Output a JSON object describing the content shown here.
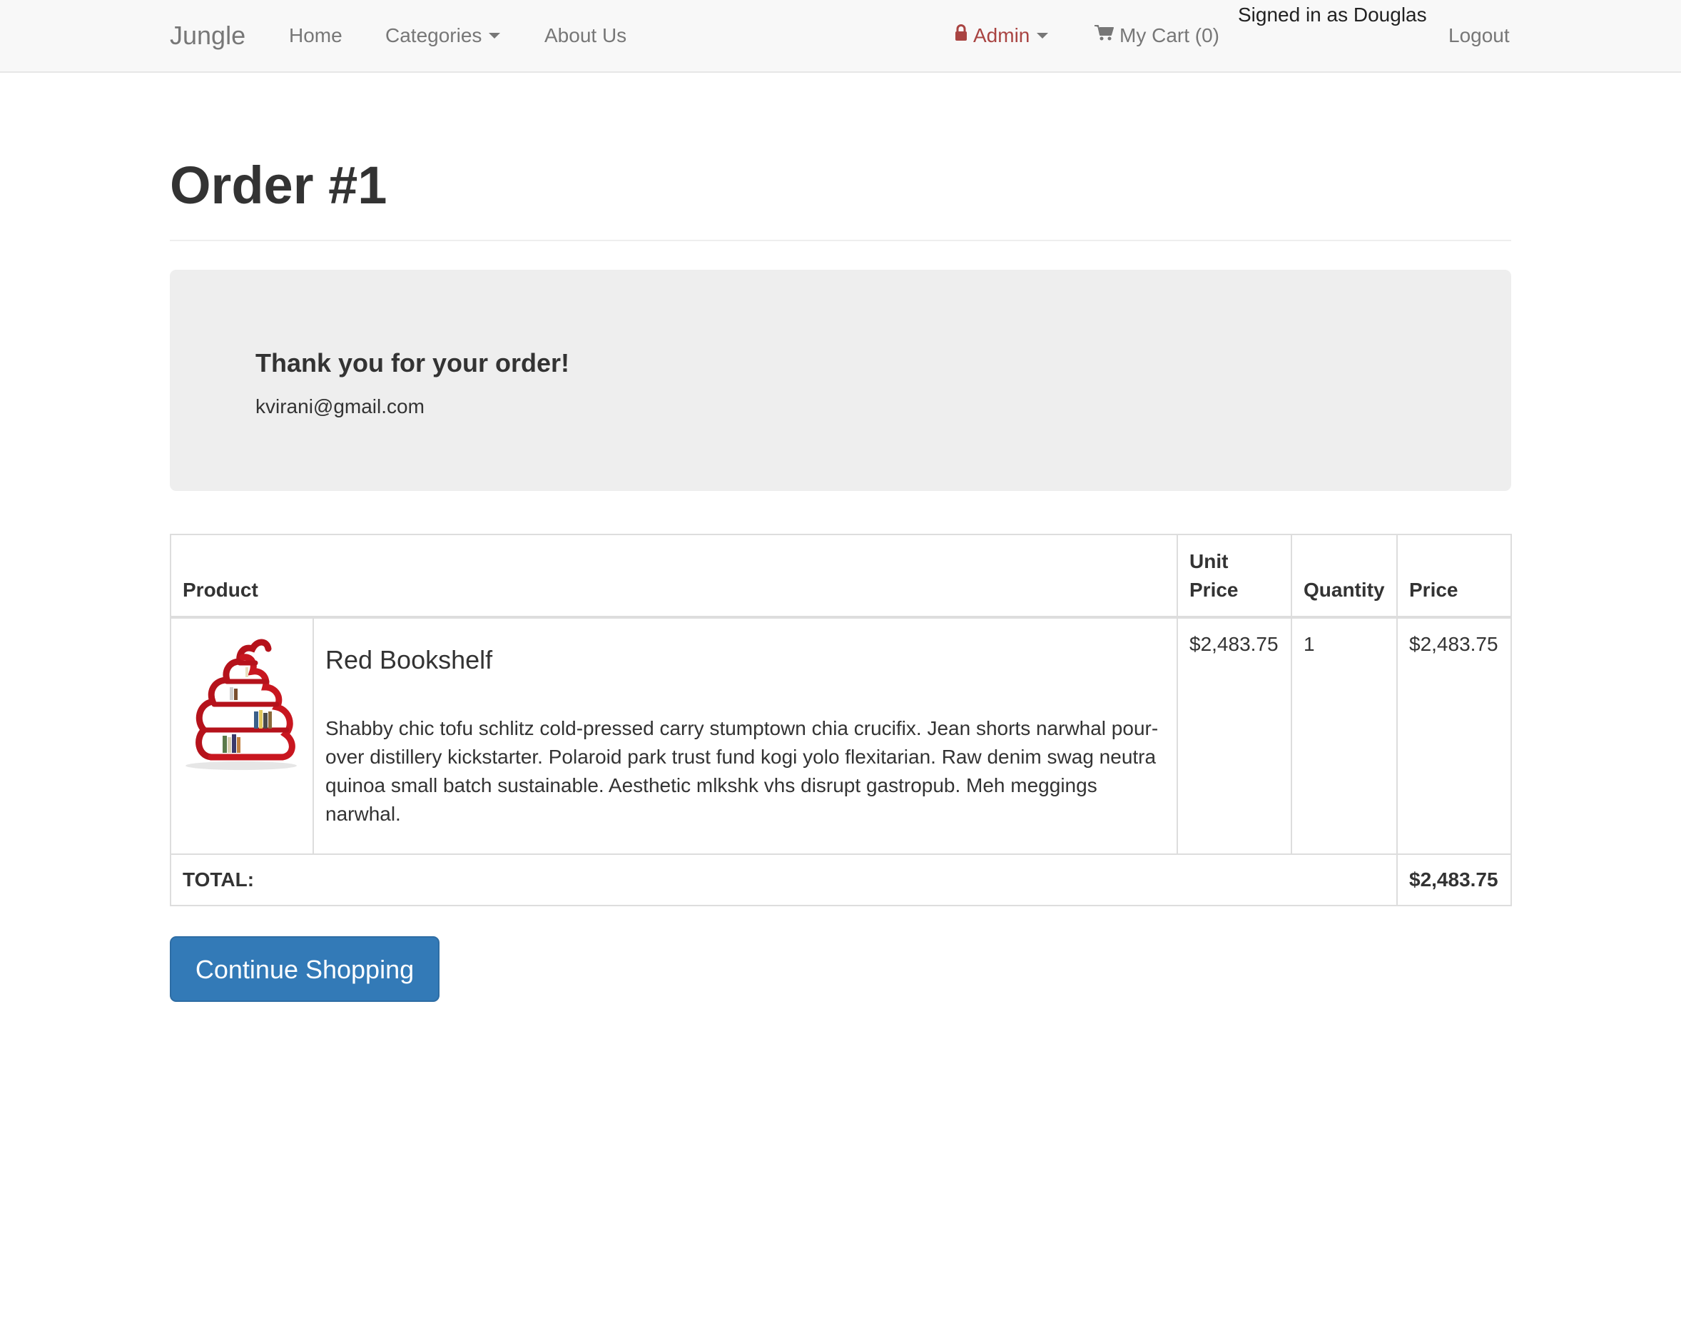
{
  "navbar": {
    "brand": "Jungle",
    "home": "Home",
    "categories": "Categories",
    "about": "About Us",
    "admin": "Admin",
    "cart": "My Cart (0)",
    "signed_in": "Signed in as Douglas",
    "logout": "Logout",
    "admin_color": "#a94442"
  },
  "page": {
    "title": "Order #1"
  },
  "jumbotron": {
    "thanks": "Thank you for your order!",
    "email": "kvirani@gmail.com"
  },
  "table": {
    "headers": {
      "product": "Product",
      "unit_price": "Unit Price",
      "quantity": "Quantity",
      "price": "Price"
    },
    "rows": [
      {
        "image": "red-bookshelf",
        "name": "Red Bookshelf",
        "description": "Shabby chic tofu schlitz cold-pressed carry stumptown chia crucifix. Jean shorts narwhal pour-over distillery kickstarter. Polaroid park trust fund kogi yolo flexitarian. Raw denim swag neutra quinoa small batch sustainable. Aesthetic mlkshk vhs disrupt gastropub. Meh meggings narwhal.",
        "unit_price": "$2,483.75",
        "quantity": "1",
        "price": "$2,483.75"
      }
    ],
    "total_label": "TOTAL:",
    "total_value": "$2,483.75"
  },
  "actions": {
    "continue_shopping": "Continue Shopping",
    "primary_color": "#337ab7"
  }
}
